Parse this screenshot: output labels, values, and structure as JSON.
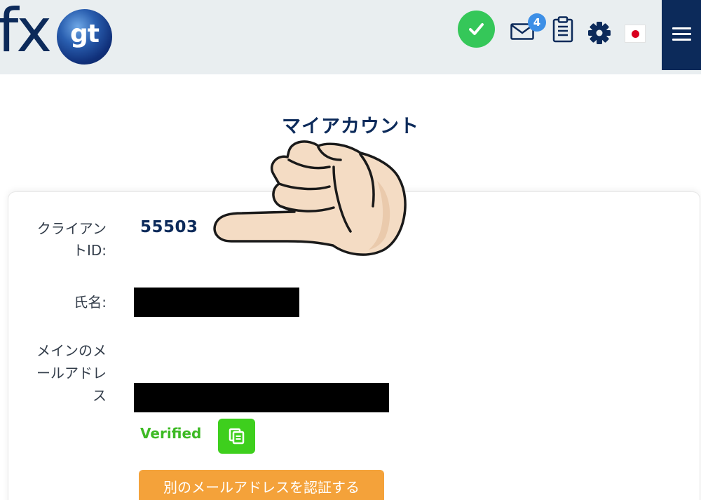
{
  "header": {
    "logo": {
      "text_fx": "fx",
      "text_gt": "gt"
    },
    "status_icon": "check-circle-icon",
    "mail": {
      "icon": "envelope-icon",
      "unread_count": "4"
    },
    "clipboard_icon": "clipboard-icon",
    "settings_icon": "gear-icon",
    "language_flag": "japan-flag",
    "menu_icon": "hamburger-menu-icon"
  },
  "page": {
    "title": "マイアカウント"
  },
  "account": {
    "client_id_label": "クライアン\nトID:",
    "client_id": "55503",
    "name_label": "氏名:",
    "email_label": "メインのメ\nールアドレ\nス",
    "email_status": "Verified",
    "copy_icon": "copy-icon",
    "verify_button": "別のメールアドレスを認証する"
  },
  "overlay": {
    "pointing_hand": "pointing-hand-illustration"
  },
  "colors": {
    "brand_navy": "#0c2a5a",
    "status_green": "#35c759",
    "verified_green": "#3dba24",
    "copy_button_green": "#3ecf1d",
    "action_orange": "#f4a23a",
    "badge_blue": "#3d8fe6"
  }
}
